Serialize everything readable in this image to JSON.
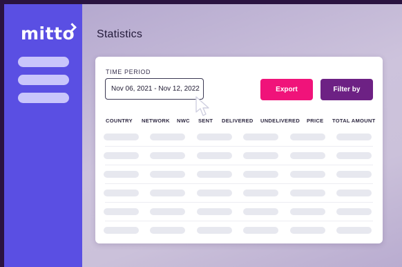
{
  "sidebar": {
    "logo_text": "mitto",
    "accent": "#5a4fe3",
    "items": [
      {
        "id": 1
      },
      {
        "id": 2
      },
      {
        "id": 3
      }
    ]
  },
  "header": {
    "title": "Statistics"
  },
  "filters": {
    "time_period_label": "TIME PERIOD",
    "date_range": "Nov 06, 2021 - Nov 12, 2022",
    "export_label": "Export",
    "filter_label": "Filter by",
    "export_color": "#f0137a",
    "filter_color": "#6d2184"
  },
  "table": {
    "columns": [
      "COUNTRY",
      "NETWORK",
      "NWC",
      "SENT",
      "DELIVERED",
      "UNDELIVERED",
      "PRICE",
      "TOTAL AMOUNT"
    ],
    "rows": [
      [
        "",
        "",
        "",
        "",
        "",
        ""
      ],
      [
        "",
        "",
        "",
        "",
        "",
        ""
      ],
      [
        "",
        "",
        "",
        "",
        "",
        ""
      ],
      [
        "",
        "",
        "",
        "",
        "",
        ""
      ],
      [
        "",
        "",
        "",
        "",
        "",
        ""
      ],
      [
        "",
        "",
        "",
        "",
        "",
        ""
      ]
    ]
  }
}
